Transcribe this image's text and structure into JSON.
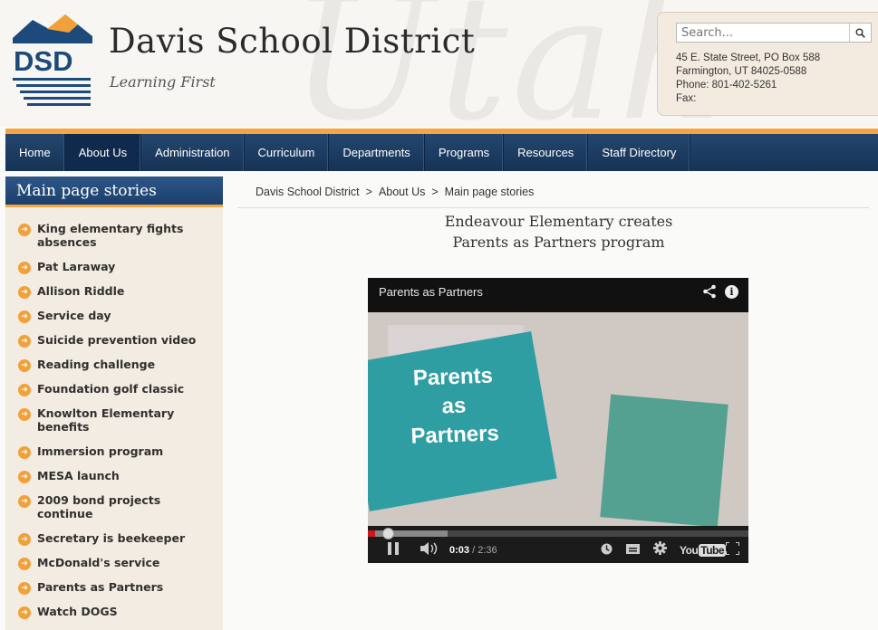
{
  "header": {
    "watermark": "Utah",
    "logo_text": "DSD",
    "site_title": "Davis School District",
    "tagline": "Learning First"
  },
  "contact": {
    "search_placeholder": "Search...",
    "address_line1": "45 E. State Street, PO Box 588",
    "address_line2": "Farmington, UT 84025-0588",
    "phone": "Phone: 801-402-5261",
    "fax": "Fax:"
  },
  "nav": {
    "items": [
      {
        "label": "Home",
        "active": false
      },
      {
        "label": "About Us",
        "active": true
      },
      {
        "label": "Administration",
        "active": false
      },
      {
        "label": "Curriculum",
        "active": false
      },
      {
        "label": "Departments",
        "active": false
      },
      {
        "label": "Programs",
        "active": false
      },
      {
        "label": "Resources",
        "active": false
      },
      {
        "label": "Staff Directory",
        "active": false
      }
    ]
  },
  "sidebar": {
    "title": "Main page stories",
    "stories": [
      "King elementary fights absences",
      "Pat Laraway",
      "Allison Riddle",
      "Service day",
      "Suicide prevention video",
      "Reading challenge",
      "Foundation golf classic",
      "Knowlton Elementary benefits",
      "Immersion program",
      "MESA launch",
      "2009 bond projects continue",
      "Secretary is beekeeper",
      "McDonald's service",
      "Parents as Partners",
      "Watch DOGS"
    ]
  },
  "breadcrumb": {
    "items": [
      "Davis School District",
      "About Us",
      "Main page stories"
    ],
    "separator": ">"
  },
  "article": {
    "title_line1": "Endeavour Elementary creates",
    "title_line2": "Parents as Partners program"
  },
  "video": {
    "title": "Parents as Partners",
    "card_line1": "Parents",
    "card_line2": "as",
    "card_line3": "Partners",
    "current_time": "0:03",
    "duration": "/ 2:36",
    "progress_fraction": 0.019,
    "buffered_fraction": 0.21,
    "youtube_logo_you": "You",
    "youtube_logo_tube": "Tube"
  },
  "colors": {
    "accent_orange": "#f5a541",
    "nav_blue": "#1b3c63",
    "sidebar_bg": "#f3ece2"
  }
}
